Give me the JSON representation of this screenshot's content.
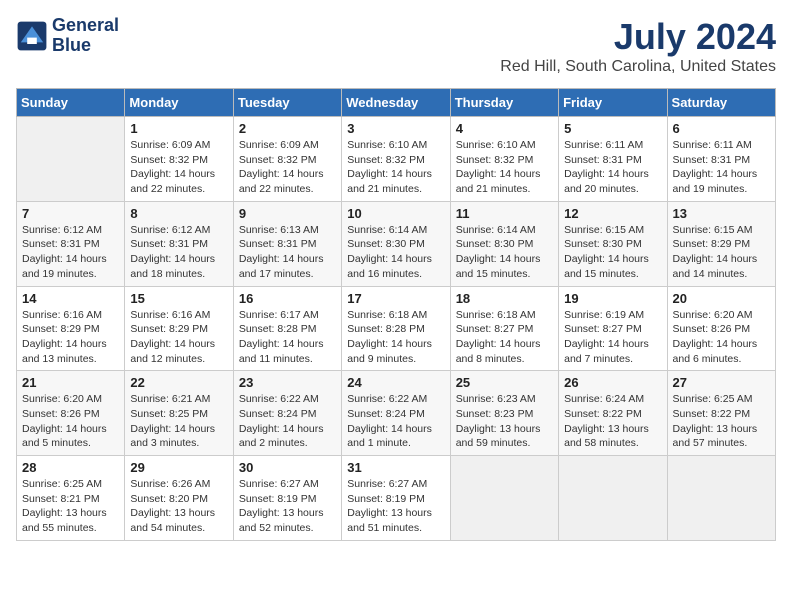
{
  "header": {
    "logo_line1": "General",
    "logo_line2": "Blue",
    "month_title": "July 2024",
    "location": "Red Hill, South Carolina, United States"
  },
  "days_of_week": [
    "Sunday",
    "Monday",
    "Tuesday",
    "Wednesday",
    "Thursday",
    "Friday",
    "Saturday"
  ],
  "weeks": [
    [
      {
        "day": "",
        "info": ""
      },
      {
        "day": "1",
        "info": "Sunrise: 6:09 AM\nSunset: 8:32 PM\nDaylight: 14 hours\nand 22 minutes."
      },
      {
        "day": "2",
        "info": "Sunrise: 6:09 AM\nSunset: 8:32 PM\nDaylight: 14 hours\nand 22 minutes."
      },
      {
        "day": "3",
        "info": "Sunrise: 6:10 AM\nSunset: 8:32 PM\nDaylight: 14 hours\nand 21 minutes."
      },
      {
        "day": "4",
        "info": "Sunrise: 6:10 AM\nSunset: 8:32 PM\nDaylight: 14 hours\nand 21 minutes."
      },
      {
        "day": "5",
        "info": "Sunrise: 6:11 AM\nSunset: 8:31 PM\nDaylight: 14 hours\nand 20 minutes."
      },
      {
        "day": "6",
        "info": "Sunrise: 6:11 AM\nSunset: 8:31 PM\nDaylight: 14 hours\nand 19 minutes."
      }
    ],
    [
      {
        "day": "7",
        "info": "Sunrise: 6:12 AM\nSunset: 8:31 PM\nDaylight: 14 hours\nand 19 minutes."
      },
      {
        "day": "8",
        "info": "Sunrise: 6:12 AM\nSunset: 8:31 PM\nDaylight: 14 hours\nand 18 minutes."
      },
      {
        "day": "9",
        "info": "Sunrise: 6:13 AM\nSunset: 8:31 PM\nDaylight: 14 hours\nand 17 minutes."
      },
      {
        "day": "10",
        "info": "Sunrise: 6:14 AM\nSunset: 8:30 PM\nDaylight: 14 hours\nand 16 minutes."
      },
      {
        "day": "11",
        "info": "Sunrise: 6:14 AM\nSunset: 8:30 PM\nDaylight: 14 hours\nand 15 minutes."
      },
      {
        "day": "12",
        "info": "Sunrise: 6:15 AM\nSunset: 8:30 PM\nDaylight: 14 hours\nand 15 minutes."
      },
      {
        "day": "13",
        "info": "Sunrise: 6:15 AM\nSunset: 8:29 PM\nDaylight: 14 hours\nand 14 minutes."
      }
    ],
    [
      {
        "day": "14",
        "info": "Sunrise: 6:16 AM\nSunset: 8:29 PM\nDaylight: 14 hours\nand 13 minutes."
      },
      {
        "day": "15",
        "info": "Sunrise: 6:16 AM\nSunset: 8:29 PM\nDaylight: 14 hours\nand 12 minutes."
      },
      {
        "day": "16",
        "info": "Sunrise: 6:17 AM\nSunset: 8:28 PM\nDaylight: 14 hours\nand 11 minutes."
      },
      {
        "day": "17",
        "info": "Sunrise: 6:18 AM\nSunset: 8:28 PM\nDaylight: 14 hours\nand 9 minutes."
      },
      {
        "day": "18",
        "info": "Sunrise: 6:18 AM\nSunset: 8:27 PM\nDaylight: 14 hours\nand 8 minutes."
      },
      {
        "day": "19",
        "info": "Sunrise: 6:19 AM\nSunset: 8:27 PM\nDaylight: 14 hours\nand 7 minutes."
      },
      {
        "day": "20",
        "info": "Sunrise: 6:20 AM\nSunset: 8:26 PM\nDaylight: 14 hours\nand 6 minutes."
      }
    ],
    [
      {
        "day": "21",
        "info": "Sunrise: 6:20 AM\nSunset: 8:26 PM\nDaylight: 14 hours\nand 5 minutes."
      },
      {
        "day": "22",
        "info": "Sunrise: 6:21 AM\nSunset: 8:25 PM\nDaylight: 14 hours\nand 3 minutes."
      },
      {
        "day": "23",
        "info": "Sunrise: 6:22 AM\nSunset: 8:24 PM\nDaylight: 14 hours\nand 2 minutes."
      },
      {
        "day": "24",
        "info": "Sunrise: 6:22 AM\nSunset: 8:24 PM\nDaylight: 14 hours\nand 1 minute."
      },
      {
        "day": "25",
        "info": "Sunrise: 6:23 AM\nSunset: 8:23 PM\nDaylight: 13 hours\nand 59 minutes."
      },
      {
        "day": "26",
        "info": "Sunrise: 6:24 AM\nSunset: 8:22 PM\nDaylight: 13 hours\nand 58 minutes."
      },
      {
        "day": "27",
        "info": "Sunrise: 6:25 AM\nSunset: 8:22 PM\nDaylight: 13 hours\nand 57 minutes."
      }
    ],
    [
      {
        "day": "28",
        "info": "Sunrise: 6:25 AM\nSunset: 8:21 PM\nDaylight: 13 hours\nand 55 minutes."
      },
      {
        "day": "29",
        "info": "Sunrise: 6:26 AM\nSunset: 8:20 PM\nDaylight: 13 hours\nand 54 minutes."
      },
      {
        "day": "30",
        "info": "Sunrise: 6:27 AM\nSunset: 8:19 PM\nDaylight: 13 hours\nand 52 minutes."
      },
      {
        "day": "31",
        "info": "Sunrise: 6:27 AM\nSunset: 8:19 PM\nDaylight: 13 hours\nand 51 minutes."
      },
      {
        "day": "",
        "info": ""
      },
      {
        "day": "",
        "info": ""
      },
      {
        "day": "",
        "info": ""
      }
    ]
  ]
}
